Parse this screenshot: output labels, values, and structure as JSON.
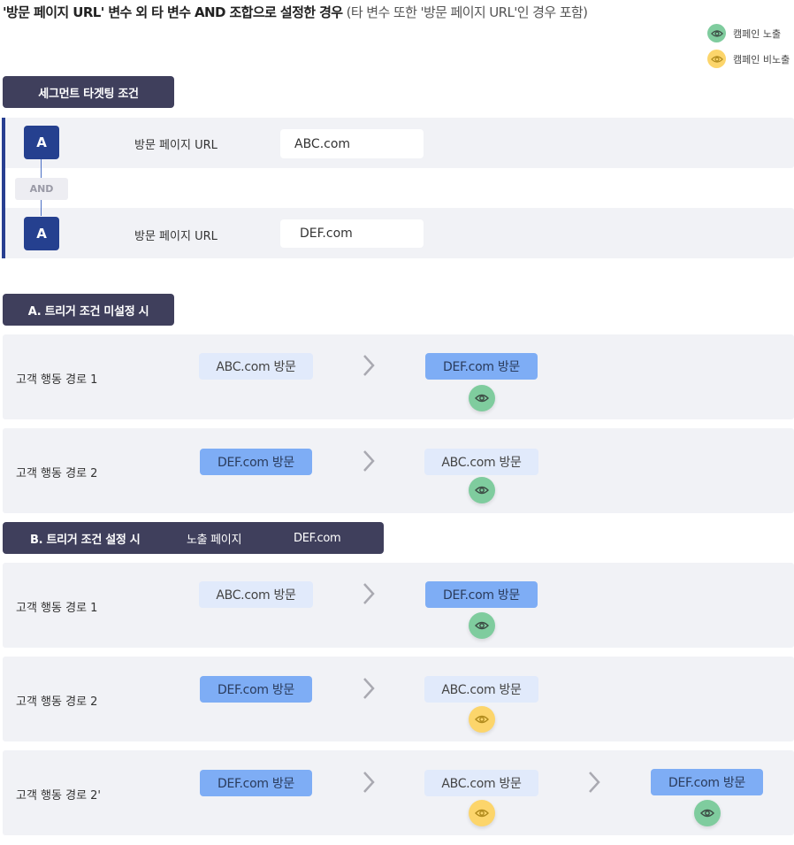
{
  "title": {
    "bold": "'방문 페이지 URL' 변수 외 타 변수 AND 조합으로 설정한 경우",
    "light": " (타 변수 또한 '방문 페이지 URL'인 경우 포함)"
  },
  "legend": [
    {
      "label": "캠페인 노출",
      "color": "#7fcc9e",
      "icon": "eye-icon"
    },
    {
      "label": "캠페인 비노출",
      "color": "#fcd56b",
      "icon": "eye-icon"
    }
  ],
  "segment": {
    "header": "세그먼트 타겟팅 조건",
    "conditions": [
      {
        "badge": "A",
        "label": "방문 페이지 URL",
        "value": "ABC.com"
      },
      {
        "badge": "A",
        "label": "방문 페이지 URL",
        "value": "DEF.com"
      }
    ],
    "operator": "AND"
  },
  "section_a": {
    "header": "A. 트리거 조건 미설정 시",
    "paths": [
      {
        "label": "고객 행동 경로 1",
        "steps": [
          "ABC.com 방문",
          "DEF.com 방문"
        ],
        "result": "노출"
      },
      {
        "label": "고객 행동 경로 2",
        "steps": [
          "DEF.com 방문",
          "ABC.com 방문"
        ],
        "result": "노출"
      }
    ]
  },
  "section_b": {
    "header": "B. 트리거 조건 설정 시",
    "trigger_label": "노출 페이지",
    "trigger_value": "DEF.com",
    "paths": [
      {
        "label": "고객 행동 경로 1",
        "steps": [
          "ABC.com 방문",
          "DEF.com 방문"
        ],
        "result": "노출"
      },
      {
        "label": "고객 행동 경로 2",
        "steps": [
          "DEF.com 방문",
          "ABC.com 방문"
        ],
        "result": "비노출"
      },
      {
        "label": "고객 행동 경로 2'",
        "steps": [
          "DEF.com 방문",
          "ABC.com 방문",
          "DEF.com 방문"
        ],
        "results": [
          "비노출",
          "노출"
        ]
      }
    ]
  },
  "colors": {
    "exposed": "#7fcc9e",
    "not_exposed": "#fcd56b",
    "header_bg": "#3f3f5c",
    "accent": "#25408f",
    "step_light": "#e1eafb",
    "step_dark": "#7eadf5"
  }
}
